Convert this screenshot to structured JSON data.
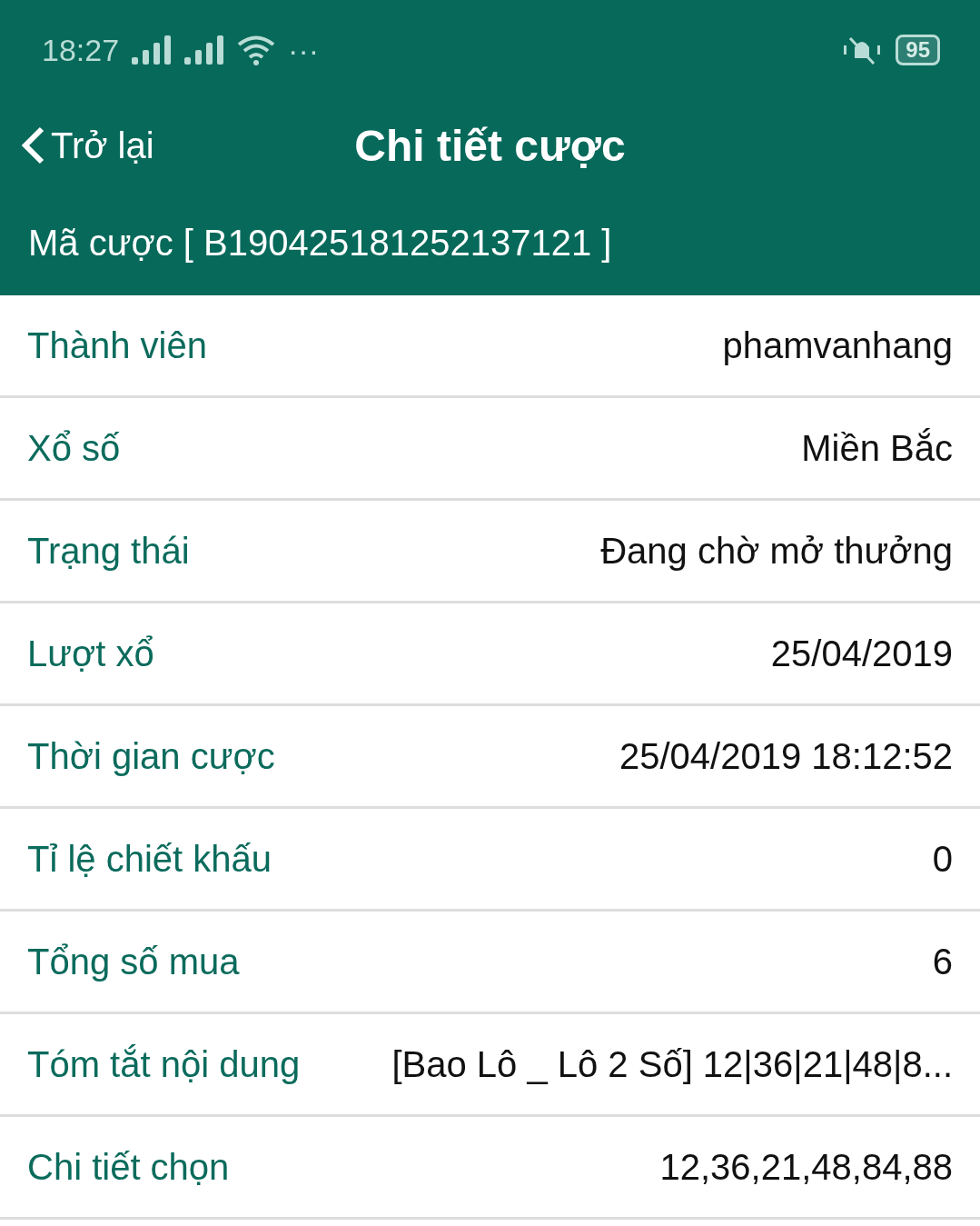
{
  "status_bar": {
    "time": "18:27",
    "more": "···",
    "battery": "95"
  },
  "header": {
    "back": "Trở lại",
    "title": "Chi tiết cược"
  },
  "bet_code": "Mã cược [ B190425181252137121 ]",
  "rows": [
    {
      "label": "Thành viên",
      "value": "phamvanhang"
    },
    {
      "label": "Xổ số",
      "value": "Miền Bắc"
    },
    {
      "label": "Trạng thái",
      "value": "Đang chờ mở thưởng"
    },
    {
      "label": "Lượt xổ",
      "value": "25/04/2019"
    },
    {
      "label": "Thời gian cược",
      "value": "25/04/2019 18:12:52"
    },
    {
      "label": "Tỉ lệ chiết khấu",
      "value": "0"
    },
    {
      "label": "Tổng số mua",
      "value": "6"
    },
    {
      "label": "Tóm tắt nội dung",
      "value": "[Bao Lô _ Lô 2 Số] 12|36|21|48|8..."
    },
    {
      "label": "Chi tiết chọn",
      "value": "12,36,21,48,84,88"
    }
  ]
}
